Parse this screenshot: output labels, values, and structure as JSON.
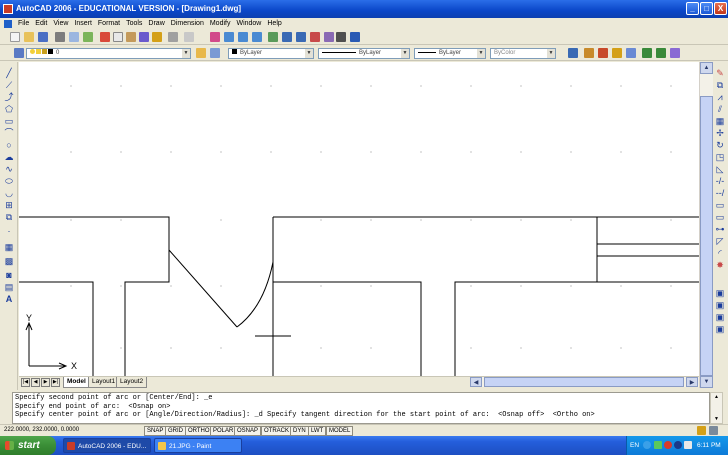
{
  "window": {
    "title": "AutoCAD 2006 - EDUCATIONAL VERSION - [Drawing1.dwg]",
    "min": "_",
    "max": "□",
    "close": "X"
  },
  "menu": [
    "File",
    "Edit",
    "View",
    "Insert",
    "Format",
    "Tools",
    "Draw",
    "Dimension",
    "Modify",
    "Window",
    "Help"
  ],
  "layer": {
    "name": "0"
  },
  "properties": {
    "color": "ByLayer",
    "linetype": "ByLayer",
    "lineweight": "ByLayer",
    "plotstyle": "ByColor"
  },
  "ucs": {
    "y": "Y",
    "x": "X"
  },
  "layout_tabs": [
    "Model",
    "Layout1",
    "Layout2"
  ],
  "command_lines": [
    "Specify second point of arc or [Center/End]: _e",
    "Specify end point of arc:  <Osnap on>",
    "Specify center point of arc or [Angle/Direction/Radius]: _d Specify tangent direction for the start point of arc:  <Osnap off>  <Ortho on>"
  ],
  "status": {
    "coords": "222.0000, 232.0000, 0.0000",
    "buttons": [
      "SNAP",
      "GRID",
      "ORTHO",
      "POLAR",
      "OSNAP",
      "OTRACK",
      "DYN",
      "LWT",
      "MODEL"
    ]
  },
  "taskbar": {
    "start": "start",
    "tasks": [
      "AutoCAD 2006 - EDU...",
      "21.JPG - Paint"
    ],
    "lang": "EN",
    "time": "6:11 PM"
  },
  "colors": {
    "titlebar": "#0a46c8",
    "taskbar": "#245edb",
    "start": "#3a8e36",
    "canvas": "#ffffff"
  }
}
